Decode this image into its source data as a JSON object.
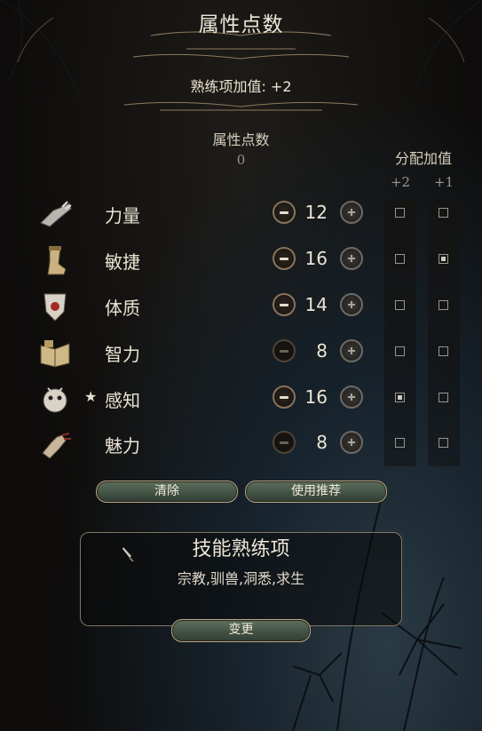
{
  "header": {
    "title": "属性点数"
  },
  "proficiency": {
    "label": "熟练项加值: +2"
  },
  "points": {
    "label": "属性点数",
    "value": "0"
  },
  "bonus": {
    "title": "分配加值",
    "plus2": "+2",
    "plus1": "+1"
  },
  "abilities": [
    {
      "name": "力量",
      "value": "12",
      "starred": false,
      "minus_enabled": true,
      "bonus2": false,
      "bonus1": false,
      "icon": "gauntlet-icon"
    },
    {
      "name": "敏捷",
      "value": "16",
      "starred": false,
      "minus_enabled": true,
      "bonus2": false,
      "bonus1": true,
      "icon": "boot-icon"
    },
    {
      "name": "体质",
      "value": "14",
      "starred": false,
      "minus_enabled": true,
      "bonus2": false,
      "bonus1": false,
      "icon": "shield-heart-icon"
    },
    {
      "name": "智力",
      "value": "8",
      "starred": false,
      "minus_enabled": false,
      "bonus2": false,
      "bonus1": false,
      "icon": "book-icon"
    },
    {
      "name": "感知",
      "value": "16",
      "starred": true,
      "minus_enabled": true,
      "bonus2": true,
      "bonus1": false,
      "icon": "owlbear-icon"
    },
    {
      "name": "魅力",
      "value": "8",
      "starred": false,
      "minus_enabled": false,
      "bonus2": false,
      "bonus1": false,
      "icon": "hand-icon"
    }
  ],
  "star_symbol": "★",
  "buttons": {
    "clear": "清除",
    "recommend": "使用推荐",
    "change": "变更"
  },
  "skills": {
    "title": "技能熟练项",
    "list": "宗教,驯兽,洞悉,求生"
  },
  "colors": {
    "button_green": "#4c5e4d",
    "gold_border": "#b8a98a",
    "text": "#ebe4d4"
  }
}
